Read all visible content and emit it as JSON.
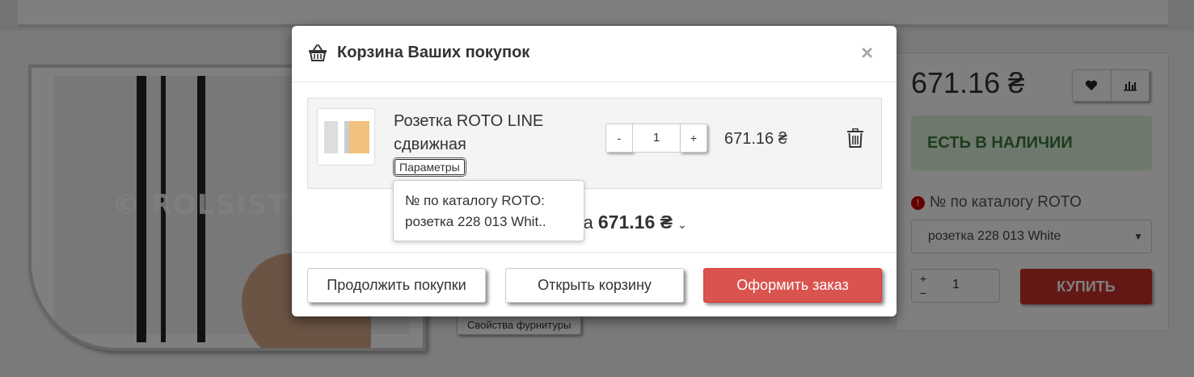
{
  "background": {
    "watermark": "© ROLSISTEM",
    "properties_button": "Свойства фурнитуры",
    "price": "671.16 ₴",
    "stock_status": "ЕСТЬ В НАЛИЧИИ",
    "catalog_label": "№ по каталогу ROTO",
    "catalog_select_value": "розетка 228 013 White",
    "quantity": "1",
    "buy_label": "КУПИТЬ"
  },
  "modal": {
    "title": "Корзина Ваших покупок",
    "close_symbol": "×",
    "item": {
      "name": "Розетка ROTO LINE сдвижная",
      "params_label": "Параметры",
      "quantity": "1",
      "minus": "-",
      "plus": "+",
      "price": "671.16 ₴"
    },
    "tooltip": {
      "line1": "№ по каталогу ROTO:",
      "line2": "розетка 228 013 Whit.."
    },
    "summary": {
      "prefix_visible": "ров, на ",
      "total": "671.16 ₴"
    },
    "footer": {
      "continue_label": "Продолжить покупки",
      "open_cart_label": "Открыть корзину",
      "checkout_label": "Оформить заказ"
    }
  },
  "colors": {
    "primary": "#d9534f",
    "stock_bg": "#dff0d8",
    "stock_text": "#3c763d"
  }
}
